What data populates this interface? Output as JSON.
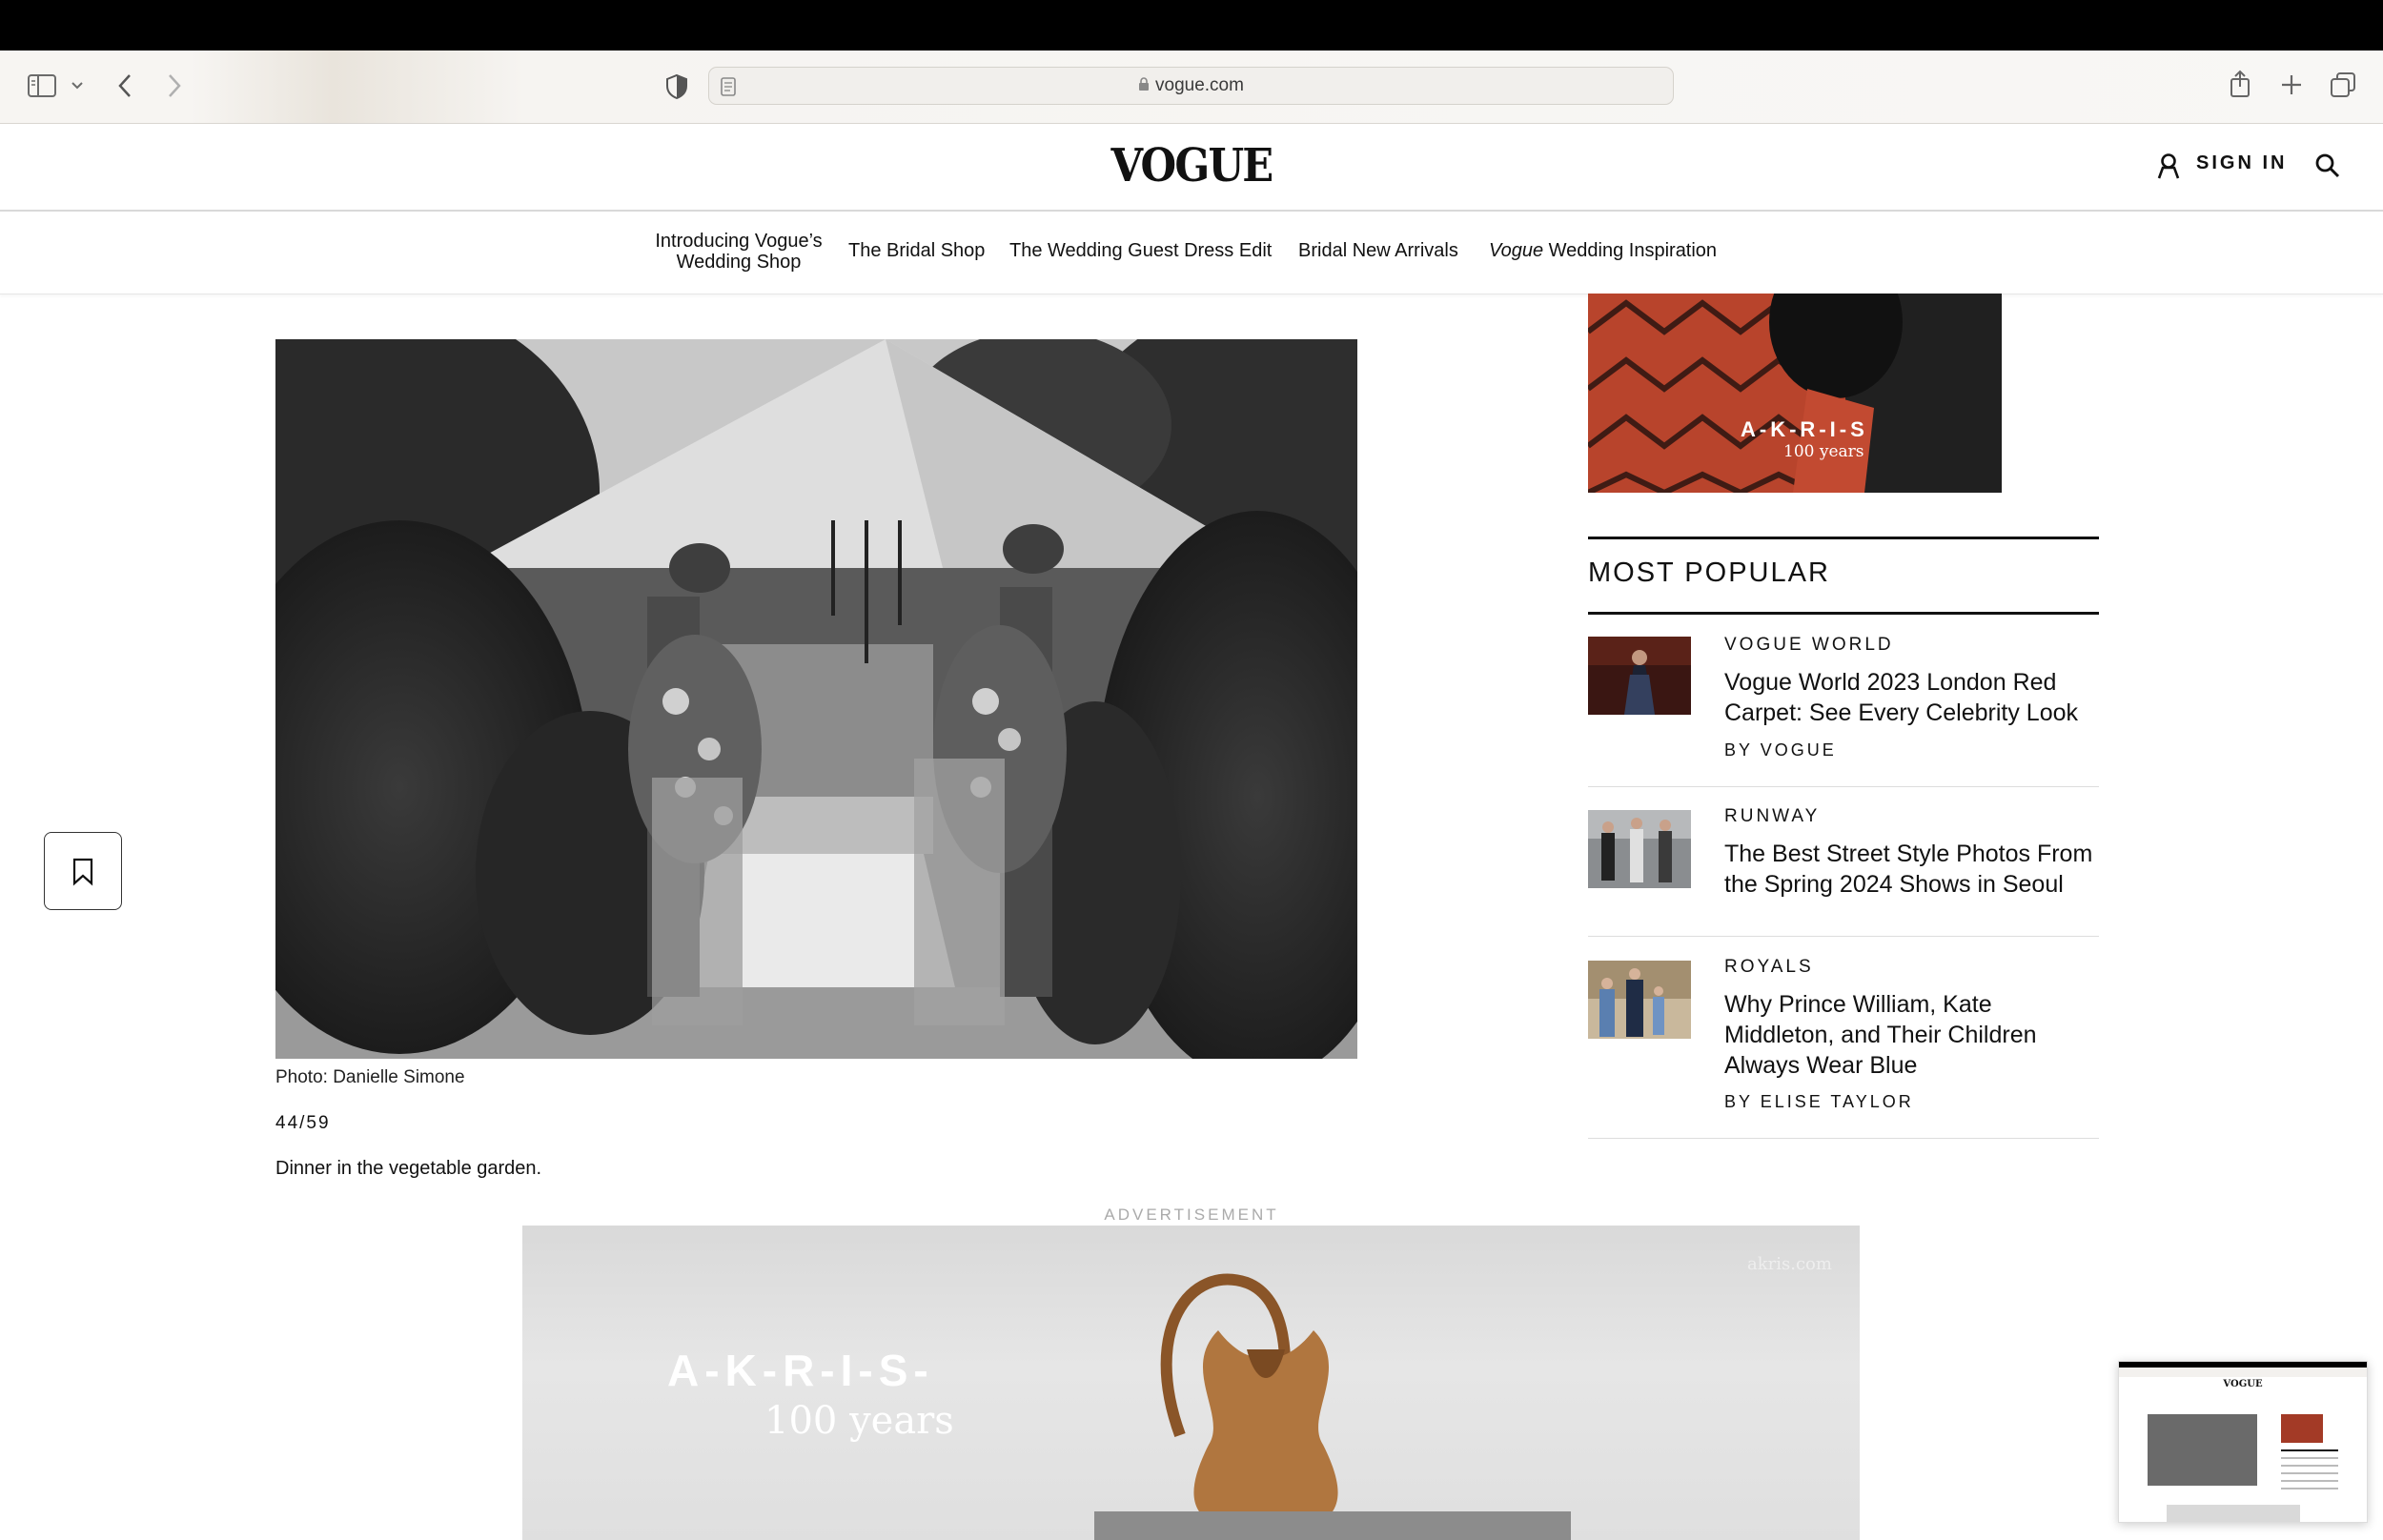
{
  "browser": {
    "url": "vogue.com",
    "icons": [
      "sidebar-icon",
      "chevron-down-icon",
      "back-icon",
      "forward-icon",
      "shield-icon",
      "reader-icon",
      "lock-icon",
      "reload-icon",
      "share-icon",
      "new-tab-icon",
      "tabs-icon"
    ]
  },
  "header": {
    "logo": "VOGUE",
    "sign_in": "SIGN IN"
  },
  "nav": {
    "items": [
      {
        "line1": "Introducing Vogue’s",
        "line2": "Wedding Shop"
      },
      {
        "label": "The Bridal Shop"
      },
      {
        "label": "The Wedding Guest Dress Edit"
      },
      {
        "label": "Bridal New Arrivals"
      },
      {
        "italic": "Vogue",
        "rest": " Wedding Inspiration"
      }
    ]
  },
  "gallery": {
    "credit": "Photo: Danielle Simone",
    "counter": "44/59",
    "caption": "Dinner in the vegetable garden."
  },
  "side_ad": {
    "brand": "A-K-R-I-S",
    "tagline": "100 years"
  },
  "most_popular": {
    "title": "MOST POPULAR",
    "items": [
      {
        "category": "VOGUE WORLD",
        "headline": "Vogue World 2023 London Red Carpet: See Every Celebrity Look",
        "byline": "BY VOGUE"
      },
      {
        "category": "RUNWAY",
        "headline": "The Best Street Style Photos From the Spring 2024 Shows in Seoul",
        "byline": ""
      },
      {
        "category": "ROYALS",
        "headline": "Why Prince William, Kate Middleton, and Their Children Always Wear Blue",
        "byline": "BY ELISE TAYLOR"
      }
    ]
  },
  "bottom_ad": {
    "label": "ADVERTISEMENT",
    "brand": "A-K-R-I-S-",
    "tagline": "100 years",
    "site": "akris.com"
  },
  "preview": {
    "logo": "VOGUE"
  }
}
